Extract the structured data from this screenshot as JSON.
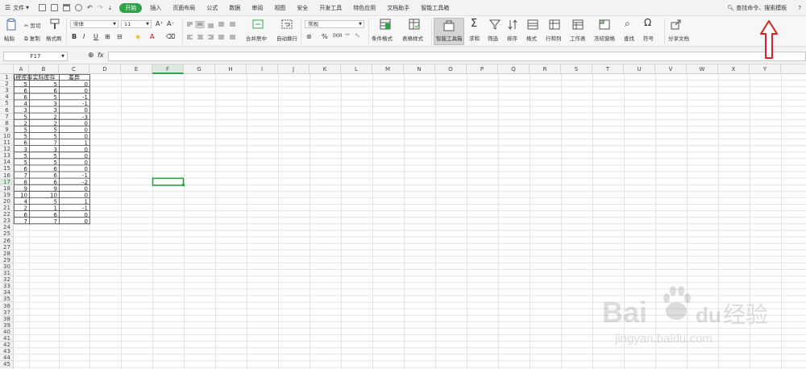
{
  "menu": {
    "file_label": "文件",
    "tabs": [
      "开始",
      "插入",
      "页面布局",
      "公式",
      "数据",
      "审阅",
      "视图",
      "安全",
      "开发工具",
      "特色应用",
      "文档助手",
      "智能工具箱"
    ],
    "active_tab": "开始",
    "search_label": "查找命令、搜索模板",
    "help_label": "?"
  },
  "ribbon": {
    "paste": "粘贴",
    "cut": "剪切",
    "copy": "复制",
    "format_painter": "格式刷",
    "font_name": "宋体",
    "font_size": "11",
    "bold": "B",
    "italic": "I",
    "underline": "U",
    "merge_center": "合并居中",
    "wrap_text": "自动换行",
    "number_format": "常规",
    "percent": "%",
    "conditional_format": "条件格式",
    "table_style": "表格样式",
    "smart_toolbox": "智能工具箱",
    "sum": "求和",
    "filter": "筛选",
    "sort": "排序",
    "format": "格式",
    "rows_cols": "行和列",
    "worksheet": "工作表",
    "freeze": "冻结窗格",
    "find": "查找",
    "symbol": "符号",
    "share": "分享文档"
  },
  "formula_bar": {
    "cell_ref": "F17",
    "fx_label": "fx",
    "formula": ""
  },
  "grid": {
    "columns": [
      "A",
      "B",
      "C",
      "D",
      "E",
      "F",
      "G",
      "H",
      "I",
      "J",
      "K",
      "L",
      "M",
      "N",
      "O",
      "P",
      "Q",
      "R",
      "S",
      "T",
      "U",
      "V",
      "W",
      "X",
      "Y"
    ],
    "selected_column": "F",
    "selected_row": 17,
    "row_count": 45,
    "headers": [
      "系统库存",
      "实际库存",
      "差异"
    ],
    "rows": [
      [
        5,
        5,
        0
      ],
      [
        6,
        6,
        0
      ],
      [
        6,
        5,
        -1
      ],
      [
        4,
        3,
        -1
      ],
      [
        3,
        3,
        0
      ],
      [
        5,
        2,
        -3
      ],
      [
        2,
        2,
        0
      ],
      [
        5,
        5,
        0
      ],
      [
        5,
        5,
        0
      ],
      [
        6,
        7,
        1
      ],
      [
        3,
        3,
        0
      ],
      [
        5,
        5,
        0
      ],
      [
        5,
        5,
        0
      ],
      [
        6,
        6,
        0
      ],
      [
        7,
        6,
        -1
      ],
      [
        8,
        6,
        -2
      ],
      [
        9,
        9,
        0
      ],
      [
        10,
        10,
        0
      ],
      [
        4,
        5,
        1
      ],
      [
        2,
        1,
        -1
      ],
      [
        6,
        6,
        0
      ],
      [
        7,
        7,
        0
      ]
    ]
  },
  "watermark": {
    "brand": "Bai",
    "brand_suffix": "du",
    "cn": "经验",
    "url": "jingyan.baidu.com"
  },
  "colors": {
    "accent": "#2aa447",
    "arrow": "#e02020",
    "grid_line": "#e3e3e3"
  }
}
